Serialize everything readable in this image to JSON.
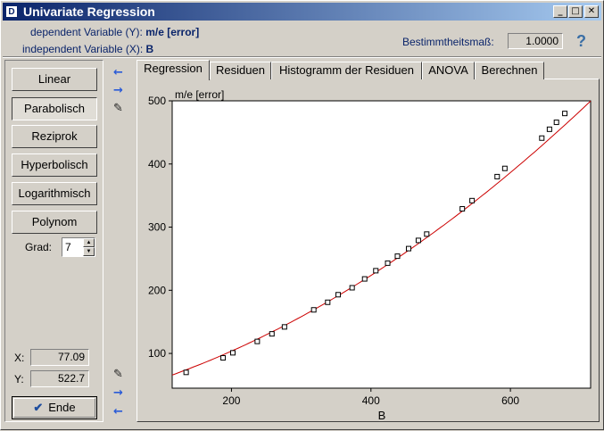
{
  "window": {
    "title": "Univariate Regression",
    "app_icon": "app-icon"
  },
  "header": {
    "dependent_label": "dependent Variable (Y):",
    "dependent_value": "m/e [error]",
    "independent_label": "independent Variable (X):",
    "independent_value": "B",
    "bestimmtheit_label": "Bestimmtheitsmaß:",
    "bestimmtheit_value": "1.0000",
    "help": "?"
  },
  "models": [
    {
      "label": "Linear",
      "pressed": false
    },
    {
      "label": "Parabolisch",
      "pressed": true
    },
    {
      "label": "Reziprok",
      "pressed": false
    },
    {
      "label": "Hyperbolisch",
      "pressed": false
    },
    {
      "label": "Logarithmisch",
      "pressed": false
    },
    {
      "label": "Polynom",
      "pressed": false
    }
  ],
  "grad": {
    "label": "Grad:",
    "value": "7"
  },
  "coords": {
    "x_label": "X:",
    "x_value": "77.09",
    "y_label": "Y:",
    "y_value": "522.7"
  },
  "ende_label": "Ende",
  "tabs": [
    "Regression",
    "Residuen",
    "Histogramm der Residuen",
    "ANOVA",
    "Berechnen"
  ],
  "active_tab": "Regression",
  "colors": {
    "fit_line": "#cc0000",
    "points": "#000000",
    "accent": "#0a246a"
  },
  "chart_data": {
    "type": "scatter",
    "xlabel": "B",
    "ylabel": "m/e [error]",
    "xlim": [
      115,
      715
    ],
    "ylim": [
      45,
      500
    ],
    "xticks": [
      200,
      400,
      600
    ],
    "yticks": [
      100,
      200,
      300,
      400,
      500
    ],
    "points": [
      [
        135,
        70
      ],
      [
        188,
        93
      ],
      [
        202,
        101
      ],
      [
        237,
        119
      ],
      [
        258,
        131
      ],
      [
        276,
        142
      ],
      [
        318,
        169
      ],
      [
        338,
        181
      ],
      [
        353,
        193
      ],
      [
        373,
        204
      ],
      [
        391,
        218
      ],
      [
        407,
        231
      ],
      [
        424,
        243
      ],
      [
        438,
        254
      ],
      [
        454,
        266
      ],
      [
        468,
        279
      ],
      [
        480,
        289
      ],
      [
        531,
        329
      ],
      [
        545,
        342
      ],
      [
        581,
        380
      ],
      [
        592,
        393
      ],
      [
        645,
        441
      ],
      [
        656,
        455
      ],
      [
        666,
        466
      ],
      [
        678,
        480
      ]
    ],
    "fit": {
      "type": "parabolic",
      "a": 26.97,
      "b": 0.2757,
      "c": 0.000539
    },
    "grid": false
  }
}
